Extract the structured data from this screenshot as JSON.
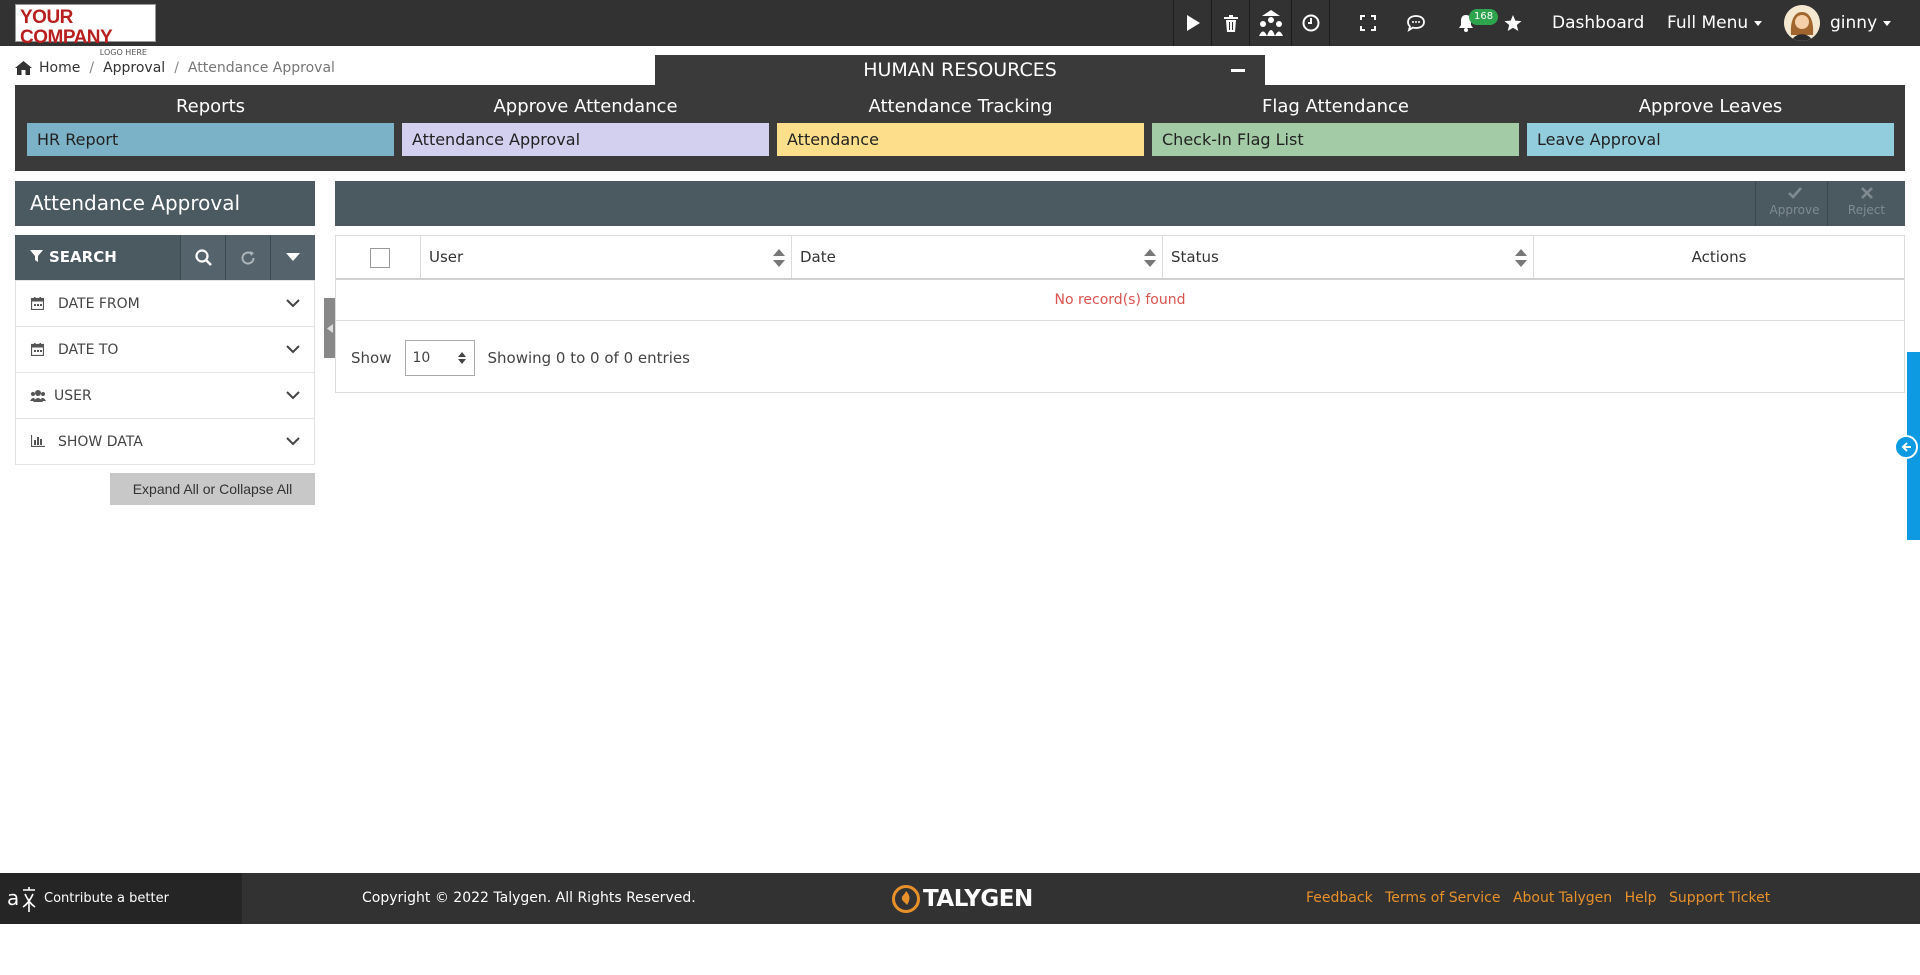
{
  "header": {
    "logo": {
      "line1": "YOUR COMPANY",
      "line2": "LOGO HERE"
    },
    "notification_count": "168",
    "dashboard_label": "Dashboard",
    "menu_label": "Full Menu",
    "user_name": "ginny"
  },
  "breadcrumb": {
    "home": "Home",
    "approval": "Approval",
    "current": "Attendance Approval"
  },
  "module": {
    "title": "HUMAN RESOURCES",
    "columns": [
      {
        "heading": "Reports",
        "item": "HR Report",
        "color": "#7cb2c8"
      },
      {
        "heading": "Approve Attendance",
        "item": "Attendance Approval",
        "color": "#d3cfef"
      },
      {
        "heading": "Attendance Tracking",
        "item": "Attendance",
        "color": "#fddf8b"
      },
      {
        "heading": "Flag Attendance",
        "item": "Check-In Flag List",
        "color": "#a3cba6"
      },
      {
        "heading": "Approve Leaves",
        "item": "Leave Approval",
        "color": "#92cddd"
      }
    ]
  },
  "sidebar": {
    "title": "Attendance Approval",
    "search_label": "SEARCH",
    "filters": [
      {
        "label": "DATE FROM",
        "icon": "calendar-icon"
      },
      {
        "label": "DATE TO",
        "icon": "calendar-icon"
      },
      {
        "label": "USER",
        "icon": "users-icon"
      },
      {
        "label": "SHOW DATA",
        "icon": "bar-chart-icon"
      }
    ],
    "expand_label": "Expand All or Collapse All"
  },
  "toolbar": {
    "approve_label": "Approve",
    "reject_label": "Reject"
  },
  "table": {
    "columns": [
      "User",
      "Date",
      "Status",
      "Actions"
    ],
    "empty_message": "No record(s) found",
    "show_label": "Show",
    "page_size": "10",
    "entries_text": "Showing 0 to 0 of 0 entries"
  },
  "footer": {
    "translate_label": "Contribute a better translation",
    "copyright": "Copyright © 2022 Talygen. All Rights Reserved.",
    "brand": "TALYGEN",
    "links": [
      "Feedback",
      "Terms of Service",
      "About Talygen",
      "Help",
      "Support Ticket"
    ]
  },
  "colors": {
    "topbar": "#323232",
    "panel": "#4b5961",
    "accent": "#0d9ae3",
    "link": "#e8912b",
    "error": "#d9534f"
  }
}
